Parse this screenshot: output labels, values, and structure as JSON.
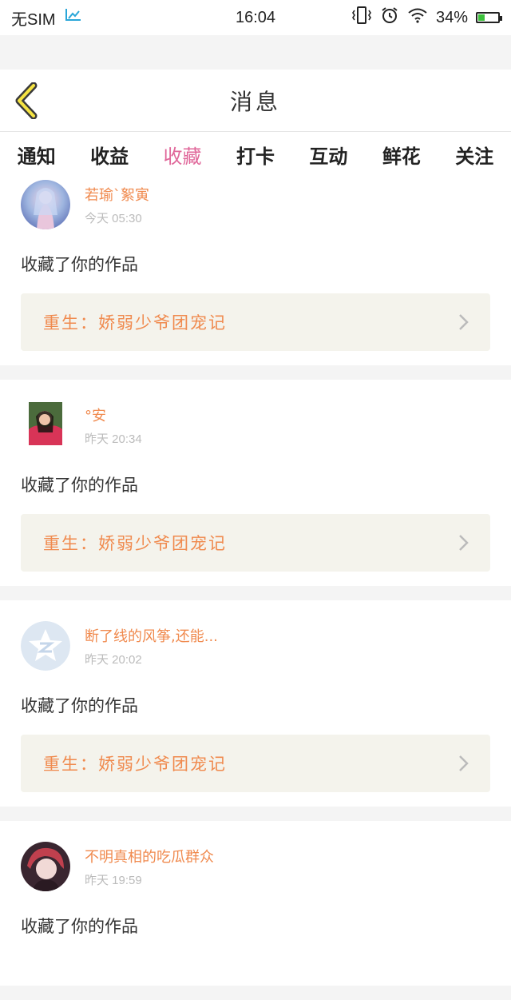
{
  "status_bar": {
    "carrier": "无SIM",
    "time": "16:04",
    "battery_percent": "34%",
    "battery_level": 0.34,
    "icons": [
      "screenshot-icon",
      "vibrate-icon",
      "alarm-icon",
      "wifi-icon",
      "battery-icon"
    ]
  },
  "header": {
    "title": "消息",
    "back_icon": "chevron-left-icon"
  },
  "tabs": [
    {
      "label": "通知",
      "active": false
    },
    {
      "label": "收益",
      "active": false
    },
    {
      "label": "收藏",
      "active": true
    },
    {
      "label": "打卡",
      "active": false
    },
    {
      "label": "互动",
      "active": false
    },
    {
      "label": "鲜花",
      "active": false
    },
    {
      "label": "关注",
      "active": false
    }
  ],
  "colors": {
    "accent": "#e0679a",
    "username": "#f08a4e",
    "work_bg": "#f4f3ec"
  },
  "feed": [
    {
      "username": "若瑜`絮寅",
      "time": "今天 05:30",
      "action": "收藏了你的作品",
      "work_title": "重生：娇弱少爷团宠记",
      "avatar": "anime-girl-avatar"
    },
    {
      "username": "°安",
      "time": "昨天 20:34",
      "action": "收藏了你的作品",
      "work_title": "重生：娇弱少爷团宠记",
      "avatar": "photo-avatar"
    },
    {
      "username": "断了线的风筝,还能...",
      "time": "昨天 20:02",
      "action": "收藏了你的作品",
      "work_title": "重生：娇弱少爷团宠记",
      "avatar": "qzone-default-avatar"
    },
    {
      "username": "不明真相的吃瓜群众",
      "time": "昨天 19:59",
      "action": "收藏了你的作品",
      "work_title": "",
      "avatar": "anime-boy-avatar"
    }
  ]
}
